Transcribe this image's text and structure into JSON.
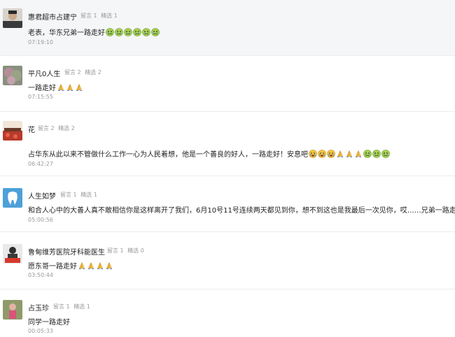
{
  "comments": [
    {
      "name": "惠君超市占建宁",
      "likes_label": "留言 1",
      "picks_label": "精选 1",
      "text": "老表，华东兄弟一路走好",
      "emojis": [
        "cry-face",
        "cry-face",
        "cry-face",
        "cry-face",
        "cry-face",
        "cry-face"
      ],
      "time": "07:19:10"
    },
    {
      "name": "平凡0人生",
      "likes_label": "留言 2",
      "picks_label": "精选 2",
      "text": "一路走好",
      "emojis": [
        "pray-hands",
        "pray-hands",
        "pray-hands"
      ],
      "time": "07:15:55"
    },
    {
      "name": "花",
      "likes_label": "留言 2",
      "picks_label": "精选 2",
      "text": "占华东从此以来不管做什么工作一心为人民着想，他是一个善良的好人，一路走好！安息吧",
      "emojis": [
        "sob-face",
        "sob-face",
        "sob-face",
        "pray-hands",
        "pray-hands",
        "pray-hands",
        "cry-face",
        "cry-face",
        "cry-face"
      ],
      "time": "06:42:27"
    },
    {
      "name": "人生如梦",
      "likes_label": "留言 1",
      "picks_label": "精选 1",
      "text": "和合人心中的大善人真不敢相信你是这样离开了我们，6月10号11号连续两天都见到你，想不到这也是我最后一次见你，哎……兄弟一路走好",
      "emojis": [],
      "time": "05:00:56"
    },
    {
      "name": "鲁甸维芳医院牙科能医生",
      "likes_label": "留言 1",
      "picks_label": "精选 0",
      "text": "愿东哥一路走好",
      "emojis": [
        "pray-hands",
        "pray-hands",
        "pray-hands",
        "pray-hands"
      ],
      "time": "03:50:44"
    },
    {
      "name": "占玉珍",
      "likes_label": "留言 1",
      "picks_label": "精选 1",
      "text": "同学一路走好",
      "emojis": [],
      "time": "00:05:33"
    }
  ],
  "colors": {
    "highlight_bg": "#f5f6f7",
    "meta_gray": "#9a9a9a",
    "emoji_green": "#9ccc4a",
    "emoji_yellow": "#f6c43a"
  }
}
